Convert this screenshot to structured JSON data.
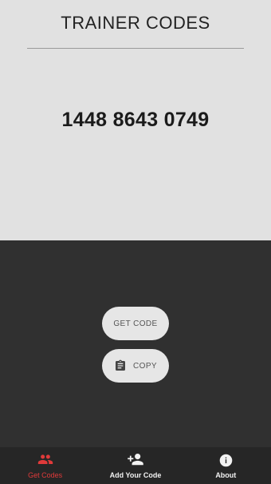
{
  "header": {
    "title": "TRAINER CODES"
  },
  "code": {
    "value": "1448 8643 0749"
  },
  "actions": {
    "get_code_label": "GET CODE",
    "copy_label": "COPY"
  },
  "nav": {
    "items": [
      {
        "label": "Get Codes",
        "icon": "people-icon",
        "active": true
      },
      {
        "label": "Add Your Code",
        "icon": "person-add-icon",
        "active": false
      },
      {
        "label": "About",
        "icon": "info-icon",
        "active": false
      }
    ]
  },
  "colors": {
    "accent": "#e03a3a",
    "top_bg": "#e1e1e1",
    "bottom_bg": "#303030",
    "nav_bg": "#262626"
  }
}
